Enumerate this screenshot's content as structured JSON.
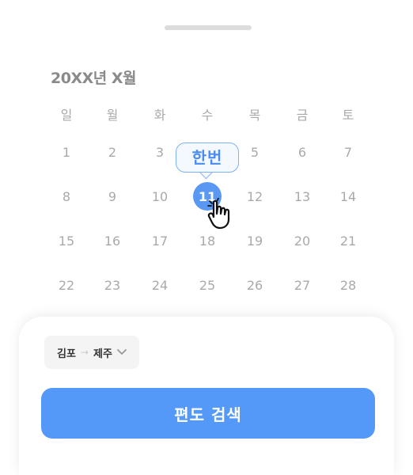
{
  "calendar": {
    "month_title": "20XX년 X월",
    "weekdays": [
      "일",
      "월",
      "화",
      "수",
      "목",
      "금",
      "토"
    ],
    "weeks": [
      [
        "1",
        "2",
        "3",
        "4",
        "5",
        "6",
        "7"
      ],
      [
        "8",
        "9",
        "10",
        "11",
        "12",
        "13",
        "14"
      ],
      [
        "15",
        "16",
        "17",
        "18",
        "19",
        "20",
        "21"
      ],
      [
        "22",
        "23",
        "24",
        "25",
        "26",
        "27",
        "28"
      ]
    ],
    "selected_day": "11",
    "tooltip": "한번"
  },
  "route": {
    "from": "김포",
    "arrow": "→",
    "to": "제주"
  },
  "search_button": {
    "label": "편도 검색"
  },
  "colors": {
    "accent": "#5599f8",
    "selected_day": "#5a98f3",
    "tooltip_border": "#7eb0f6"
  }
}
